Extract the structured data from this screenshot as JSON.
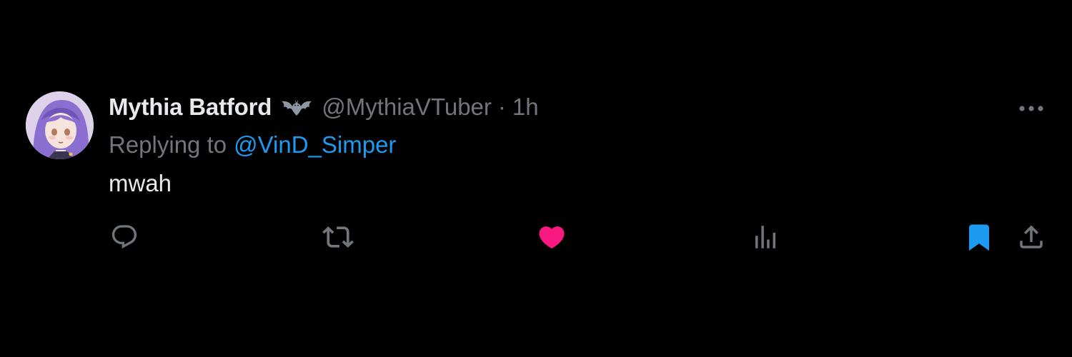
{
  "tweet": {
    "display_name": "Mythia Batford",
    "badge_icon": "bat-icon",
    "handle": "@MythiaVTuber",
    "separator": "·",
    "time": "1h",
    "reply_prefix": "Replying to",
    "reply_to": "@VinD_Simper",
    "text": "mwah",
    "avatar_icon": "avatar-anime-purple-hair"
  },
  "actions": [
    {
      "name": "reply-button",
      "icon": "speech-bubble-icon"
    },
    {
      "name": "retweet-button",
      "icon": "retweet-arrows-icon"
    },
    {
      "name": "like-button",
      "icon": "heart-icon",
      "state": "liked"
    },
    {
      "name": "views-button",
      "icon": "bar-chart-icon"
    },
    {
      "name": "bookmark-button",
      "icon": "bookmark-icon",
      "state": "bookmarked"
    },
    {
      "name": "share-button",
      "icon": "share-upload-icon"
    }
  ],
  "colors": {
    "background": "#000000",
    "text_primary": "#e7e9ea",
    "text_secondary": "#71767b",
    "link": "#1d9bf0",
    "like": "#f91880",
    "bookmark": "#1d9bf0",
    "avatar_hair": "#8a6fd0"
  }
}
